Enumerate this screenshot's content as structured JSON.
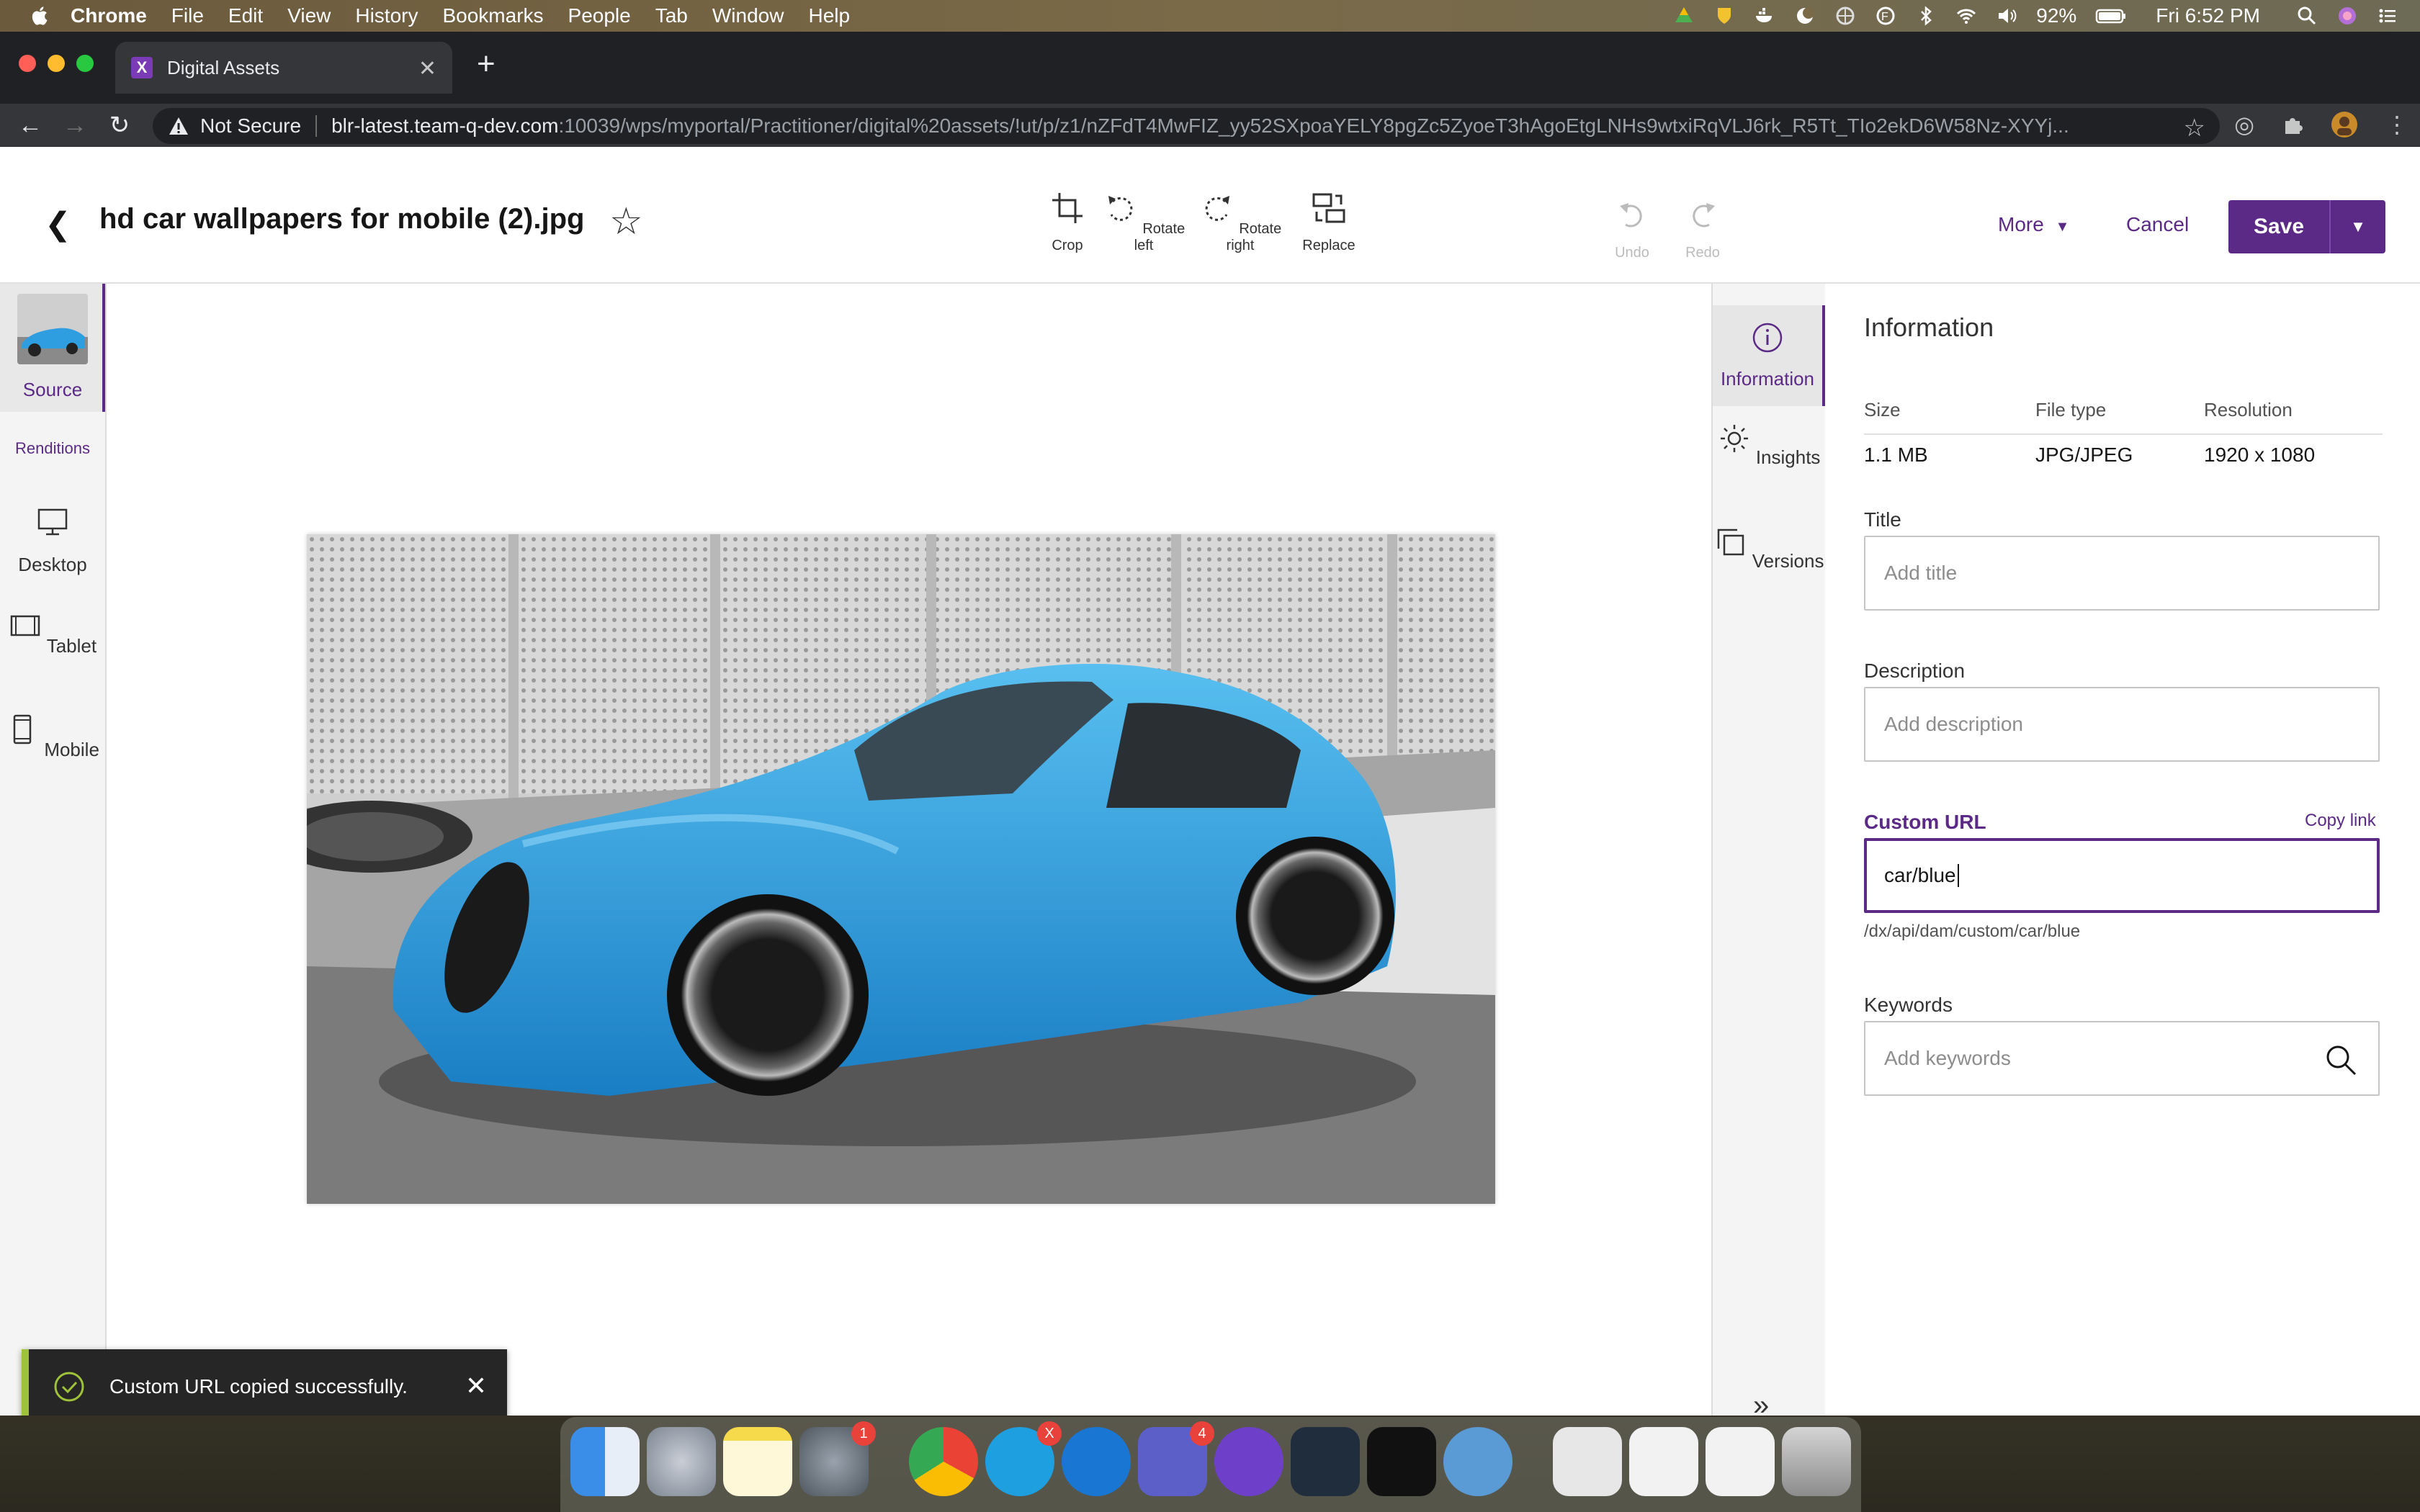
{
  "menubar": {
    "app": "Chrome",
    "items": [
      "File",
      "Edit",
      "View",
      "History",
      "Bookmarks",
      "People",
      "Tab",
      "Window",
      "Help"
    ],
    "battery": "92%",
    "clock": "Fri 6:52 PM"
  },
  "browser": {
    "tab_title": "Digital Assets",
    "security": "Not Secure",
    "url_host": "blr-latest.team-q-dev.com",
    "url_path": ":10039/wps/myportal/Practitioner/digital%20assets/!ut/p/z1/nZFdT4MwFIZ_yy52SXpoaYELY8pgZc5ZyoeT3hAgoEtgLNHs9wtxiRqVLJ6rk_R5Tt_TIo2ekD6W58Nz-XYYj..."
  },
  "header": {
    "filename": "hd car wallpapers for mobile (2).jpg",
    "tools": [
      {
        "label": "Crop",
        "icon": "crop-icon"
      },
      {
        "label": "Rotate left",
        "icon": "rotate-left-icon"
      },
      {
        "label": "Rotate right",
        "icon": "rotate-right-icon"
      },
      {
        "label": "Replace",
        "icon": "replace-icon"
      }
    ],
    "undo": "Undo",
    "redo": "Redo",
    "more": "More",
    "cancel": "Cancel",
    "save": "Save"
  },
  "leftrail": {
    "source": "Source",
    "renditions": "Renditions",
    "items": [
      {
        "label": "Desktop",
        "icon": "desktop-icon"
      },
      {
        "label": "Tablet",
        "icon": "tablet-icon"
      },
      {
        "label": "Mobile",
        "icon": "mobile-icon"
      }
    ]
  },
  "sidetabs": {
    "items": [
      {
        "label": "Information",
        "icon": "info-icon"
      },
      {
        "label": "Insights",
        "icon": "insights-icon"
      },
      {
        "label": "Versions",
        "icon": "versions-icon"
      }
    ]
  },
  "info": {
    "heading": "Information",
    "size_label": "Size",
    "size_value": "1.1 MB",
    "type_label": "File type",
    "type_value": "JPG/JPEG",
    "res_label": "Resolution",
    "res_value": "1920 x 1080",
    "title_label": "Title",
    "title_placeholder": "Add title",
    "desc_label": "Description",
    "desc_placeholder": "Add description",
    "url_label": "Custom URL",
    "copy_link": "Copy link",
    "url_value": "car/blue",
    "url_hint": "/dx/api/dam/custom/car/blue",
    "keywords_label": "Keywords",
    "keywords_placeholder": "Add keywords"
  },
  "toast": {
    "message": "Custom URL copied successfully."
  },
  "dock": {
    "badges": {
      "settings": "1",
      "skype": "X",
      "teams": "4"
    }
  },
  "colors": {
    "accent": "#5b2a86",
    "toast_success": "#9ec23a"
  }
}
